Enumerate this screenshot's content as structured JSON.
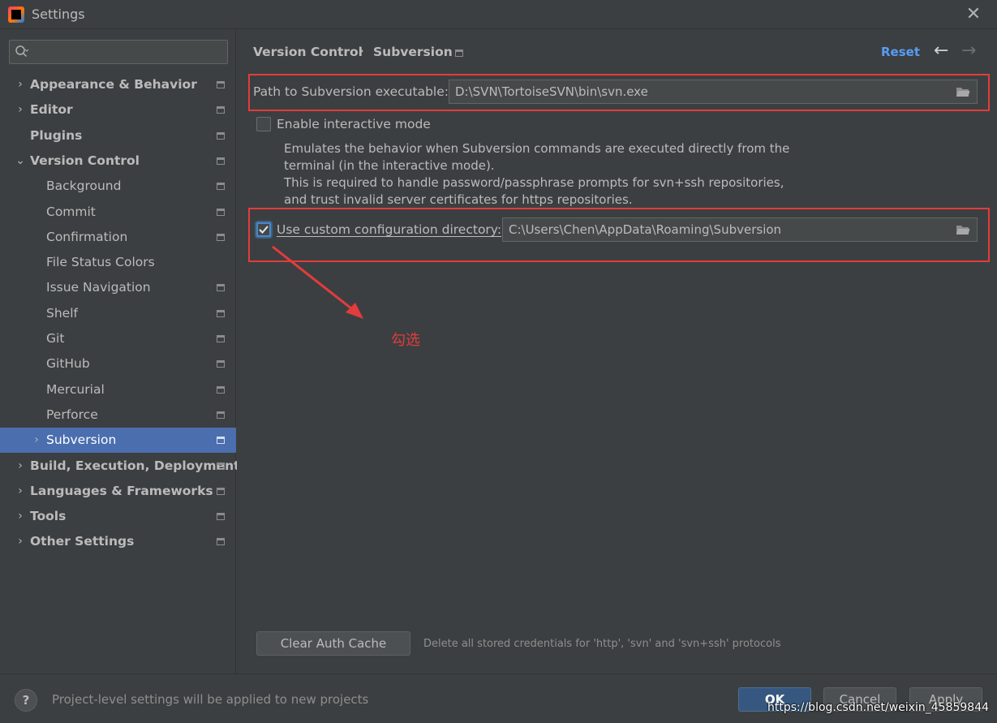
{
  "window": {
    "title": "Settings",
    "close_glyph": "✕"
  },
  "search": {
    "placeholder": ""
  },
  "sidebar": {
    "items": [
      {
        "label": "Appearance & Behavior",
        "arrow": "›",
        "level": 0,
        "bold": true,
        "has_project_icon": true
      },
      {
        "label": "Editor",
        "arrow": "›",
        "level": 0,
        "bold": true,
        "has_project_icon": true
      },
      {
        "label": "Plugins",
        "arrow": "",
        "level": 0,
        "bold": true,
        "has_project_icon": true
      },
      {
        "label": "Version Control",
        "arrow": "⌄",
        "level": 0,
        "bold": true,
        "has_project_icon": true
      },
      {
        "label": "Background",
        "arrow": "",
        "level": 1,
        "bold": false,
        "has_project_icon": true
      },
      {
        "label": "Commit",
        "arrow": "",
        "level": 1,
        "bold": false,
        "has_project_icon": true
      },
      {
        "label": "Confirmation",
        "arrow": "",
        "level": 1,
        "bold": false,
        "has_project_icon": true
      },
      {
        "label": "File Status Colors",
        "arrow": "",
        "level": 1,
        "bold": false,
        "has_project_icon": false
      },
      {
        "label": "Issue Navigation",
        "arrow": "",
        "level": 1,
        "bold": false,
        "has_project_icon": true
      },
      {
        "label": "Shelf",
        "arrow": "",
        "level": 1,
        "bold": false,
        "has_project_icon": true
      },
      {
        "label": "Git",
        "arrow": "",
        "level": 1,
        "bold": false,
        "has_project_icon": true
      },
      {
        "label": "GitHub",
        "arrow": "",
        "level": 1,
        "bold": false,
        "has_project_icon": true
      },
      {
        "label": "Mercurial",
        "arrow": "",
        "level": 1,
        "bold": false,
        "has_project_icon": true
      },
      {
        "label": "Perforce",
        "arrow": "",
        "level": 1,
        "bold": false,
        "has_project_icon": true
      },
      {
        "label": "Subversion",
        "arrow": "›",
        "level": 1,
        "bold": false,
        "has_project_icon": true,
        "selected": true
      },
      {
        "label": "Build, Execution, Deployment",
        "arrow": "›",
        "level": 0,
        "bold": true,
        "has_project_icon": true
      },
      {
        "label": "Languages & Frameworks",
        "arrow": "›",
        "level": 0,
        "bold": true,
        "has_project_icon": true
      },
      {
        "label": "Tools",
        "arrow": "›",
        "level": 0,
        "bold": true,
        "has_project_icon": true
      },
      {
        "label": "Other Settings",
        "arrow": "›",
        "level": 0,
        "bold": true,
        "has_project_icon": true
      }
    ]
  },
  "breadcrumb": {
    "parent": "Version Control",
    "separator": "›",
    "current": "Subversion"
  },
  "header": {
    "reset_label": "Reset",
    "back_glyph": "←",
    "forward_glyph": "→"
  },
  "form": {
    "svn_path_label": "Path to Subversion executable:",
    "svn_path_value": "D:\\SVN\\TortoiseSVN\\bin\\svn.exe",
    "interactive_label": "Enable interactive mode",
    "interactive_checked": false,
    "interactive_desc": [
      "Emulates the behavior when Subversion commands are executed directly from the",
      "terminal (in the interactive mode).",
      "This is required to handle password/passphrase prompts for svn+ssh repositories,",
      "and trust invalid server certificates for https repositories."
    ],
    "config_dir_label": "Use custom configuration directory:",
    "config_dir_checked": true,
    "config_dir_value": "C:\\Users\\Chen\\AppData\\Roaming\\Subversion"
  },
  "annotation": {
    "text": "勾选"
  },
  "auth": {
    "clear_button": "Clear Auth Cache",
    "hint": "Delete all stored credentials for 'http', 'svn' and 'svn+ssh' protocols"
  },
  "footer": {
    "help_glyph": "?",
    "note": "Project-level settings will be applied to new projects",
    "ok_label": "OK",
    "cancel_label": "Cancel",
    "apply_label": "Apply"
  },
  "watermark": "https://blog.csdn.net/weixin_45859844",
  "colors": {
    "background": "#3c3f41",
    "selection": "#4b6eaf",
    "link": "#589df6",
    "annotation_red": "#e23c3c",
    "primary_button": "#365880"
  }
}
